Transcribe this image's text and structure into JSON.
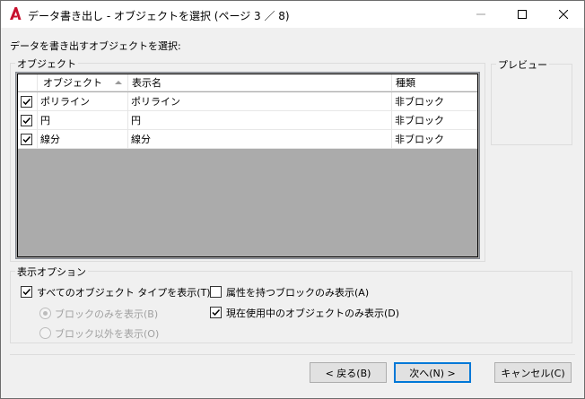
{
  "window": {
    "title": "データ書き出し - オブジェクトを選択 (ページ 3 ／ 8)",
    "accent_color": "#c8102e"
  },
  "instruction": "データを書き出すオブジェクトを選択:",
  "objects_group": {
    "label": "オブジェクト",
    "columns": [
      "オブジェクト",
      "表示名",
      "種類"
    ],
    "rows": [
      {
        "checked": true,
        "object": "ポリライン",
        "display_name": "ポリライン",
        "type": "非ブロック"
      },
      {
        "checked": true,
        "object": "円",
        "display_name": "円",
        "type": "非ブロック"
      },
      {
        "checked": true,
        "object": "線分",
        "display_name": "線分",
        "type": "非ブロック"
      }
    ]
  },
  "preview_group": {
    "label": "プレビュー"
  },
  "display_options": {
    "label": "表示オプション",
    "show_all_types": {
      "label": "すべてのオブジェクト タイプを表示(T)",
      "checked": true
    },
    "blocks_only": {
      "label": "ブロックのみを表示(B)",
      "selected": true,
      "enabled": false
    },
    "non_blocks_only": {
      "label": "ブロック以外を表示(O)",
      "selected": false,
      "enabled": false
    },
    "attr_blocks_only": {
      "label": "属性を持つブロックのみ表示(A)",
      "checked": false
    },
    "in_use_only": {
      "label": "現在使用中のオブジェクトのみ表示(D)",
      "checked": true
    }
  },
  "buttons": {
    "back": "< 戻る(B)",
    "next": "次へ(N) >",
    "cancel": "キャンセル(C)"
  }
}
